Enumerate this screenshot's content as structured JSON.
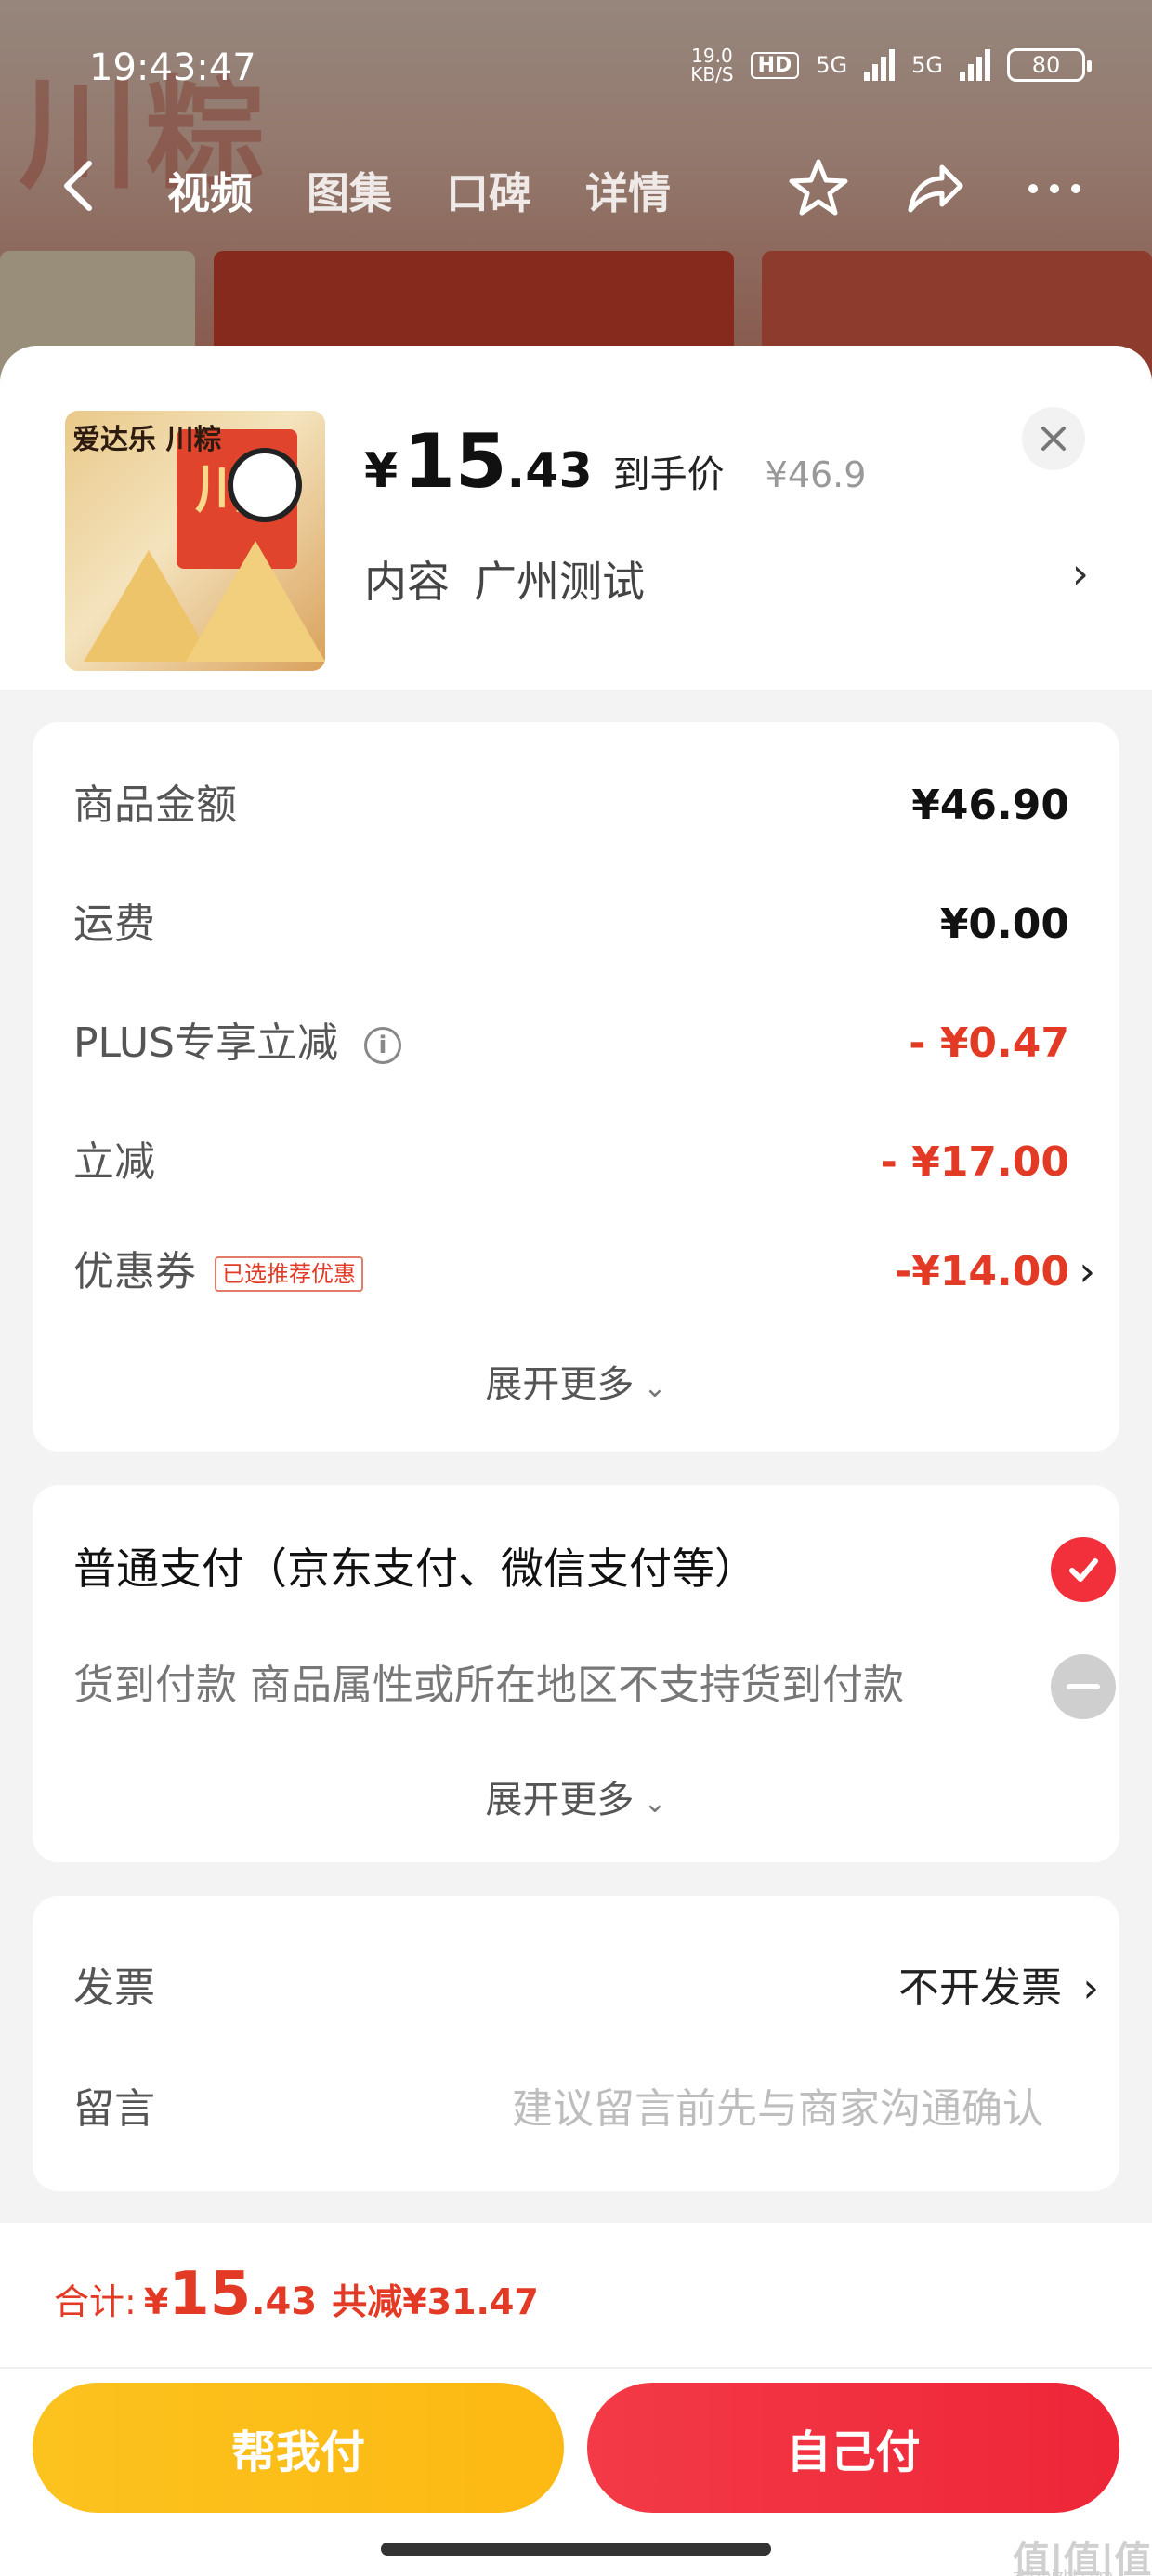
{
  "status_bar": {
    "time": "19:43:47",
    "net_speed_value": "19.0",
    "net_speed_unit": "KB/S",
    "hd_badge": "HD",
    "signal_1": "5G",
    "signal_2": "5G",
    "battery": "80"
  },
  "top_nav": {
    "tabs": [
      {
        "label": "视频",
        "active": true
      },
      {
        "label": "图集",
        "active": false
      },
      {
        "label": "口碑",
        "active": false
      },
      {
        "label": "详情",
        "active": false
      }
    ]
  },
  "product": {
    "price_currency": "¥",
    "price_int": "15",
    "price_dec": ".43",
    "price_label": "到手价",
    "original_price": "¥46.9",
    "spec_label": "内容",
    "spec_value": "广州测试",
    "thumb_logo_text": "爱达乐 川粽",
    "thumb_char": "川"
  },
  "amounts": {
    "rows": [
      {
        "label": "商品金额",
        "value": "¥46.90"
      },
      {
        "label": "运费",
        "value": "¥0.00"
      },
      {
        "label": "PLUS专享立减",
        "value": "- ¥0.47"
      },
      {
        "label": "立减",
        "value": "- ¥17.00"
      },
      {
        "label": "优惠券",
        "tag": "已选推荐优惠",
        "value": "-¥14.00"
      }
    ],
    "expand_label": "展开更多"
  },
  "payment": {
    "options": [
      {
        "label": "普通支付（京东支付、微信支付等）",
        "selected": true
      },
      {
        "label": "货到付款 商品属性或所在地区不支持货到付款",
        "disabled": true
      }
    ],
    "expand_label": "展开更多"
  },
  "invoice": {
    "invoice_label": "发票",
    "invoice_value": "不开发票",
    "message_label": "留言",
    "message_placeholder": "建议留言前先与商家沟通确认"
  },
  "footer": {
    "total_label": "合计:",
    "total_currency": "¥",
    "total_int": "15",
    "total_dec": ".43",
    "total_saved": "共减¥31.47",
    "help_pay_label": "帮我付",
    "self_pay_label": "自己付",
    "watermark": "值|值|值",
    "watermark_url": "zhizhizhi.com"
  },
  "colors": {
    "accent_red": "#e33a26",
    "pay_red": "#ee2638",
    "help_yellow": "#fdb913"
  }
}
